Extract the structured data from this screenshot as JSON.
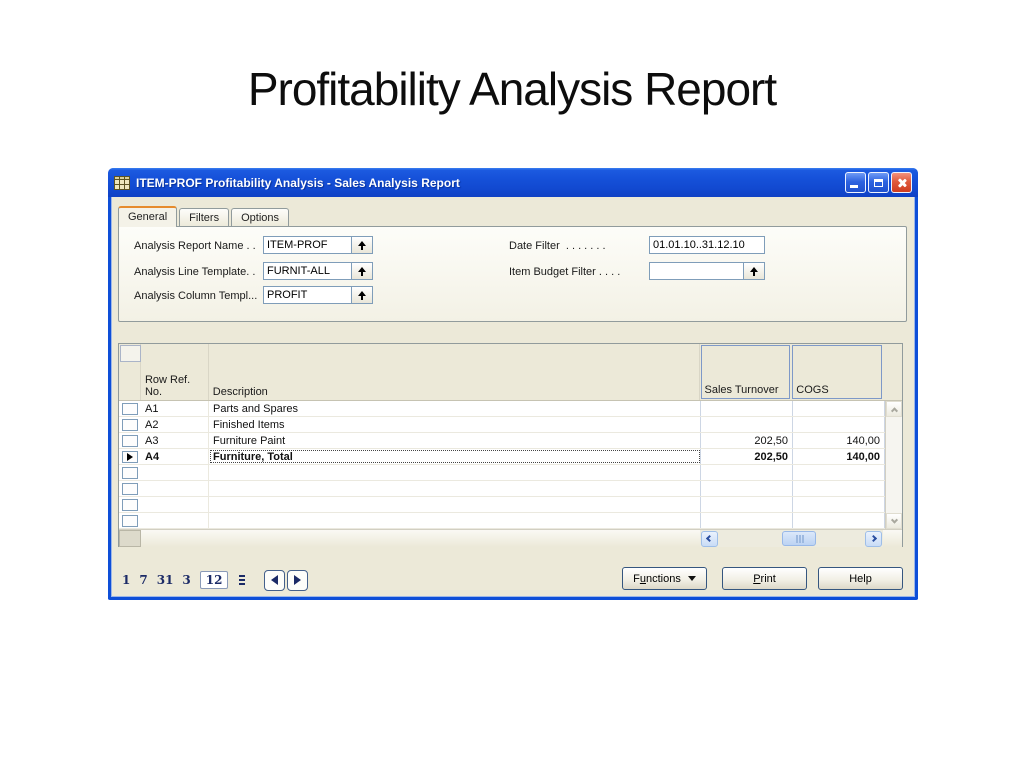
{
  "slide": {
    "title": "Profitability Analysis Report"
  },
  "window": {
    "title": "ITEM-PROF Profitability Analysis - Sales Analysis Report"
  },
  "tabs": [
    {
      "label": "General",
      "active": true
    },
    {
      "label": "Filters",
      "active": false
    },
    {
      "label": "Options",
      "active": false
    }
  ],
  "fields": {
    "left": [
      {
        "label": "Analysis Report Name . .",
        "value": "ITEM-PROF",
        "lookup": true
      },
      {
        "label": "Analysis Line Template. .",
        "value": "FURNIT-ALL",
        "lookup": true
      },
      {
        "label": "Analysis Column Templ...",
        "value": "PROFIT",
        "lookup": true
      }
    ],
    "right": [
      {
        "label": "Date Filter  . . . . . . .",
        "value": "01.01.10..31.12.10",
        "lookup": false
      },
      {
        "label": "Item Budget Filter . . . .",
        "value": "",
        "lookup": true
      }
    ]
  },
  "grid": {
    "headers": {
      "row_ref_line1": "Row Ref.",
      "row_ref_line2": "No.",
      "description": "Description",
      "sales_turnover": "Sales Turnover",
      "cogs": "COGS"
    },
    "rows": [
      {
        "ref": "A1",
        "description": "Parts and Spares",
        "sales_turnover": "",
        "cogs": ""
      },
      {
        "ref": "A2",
        "description": "Finished Items",
        "sales_turnover": "",
        "cogs": ""
      },
      {
        "ref": "A3",
        "description": "Furniture Paint",
        "sales_turnover": "202,50",
        "cogs": "140,00"
      },
      {
        "ref": "A4",
        "description": "Furniture, Total",
        "sales_turnover": "202,50",
        "cogs": "140,00"
      }
    ],
    "selected_row_ref": "A4"
  },
  "period_bar": {
    "day": "1",
    "week": "7",
    "month": "31",
    "quarter": "3",
    "year": "12",
    "selected": "12"
  },
  "action_buttons": {
    "functions": {
      "pre": "F",
      "accel": "u",
      "post": "nctions"
    },
    "print": {
      "pre": "",
      "accel": "P",
      "post": "rint"
    },
    "help": {
      "pre": "Help",
      "accel": "",
      "post": ""
    }
  }
}
